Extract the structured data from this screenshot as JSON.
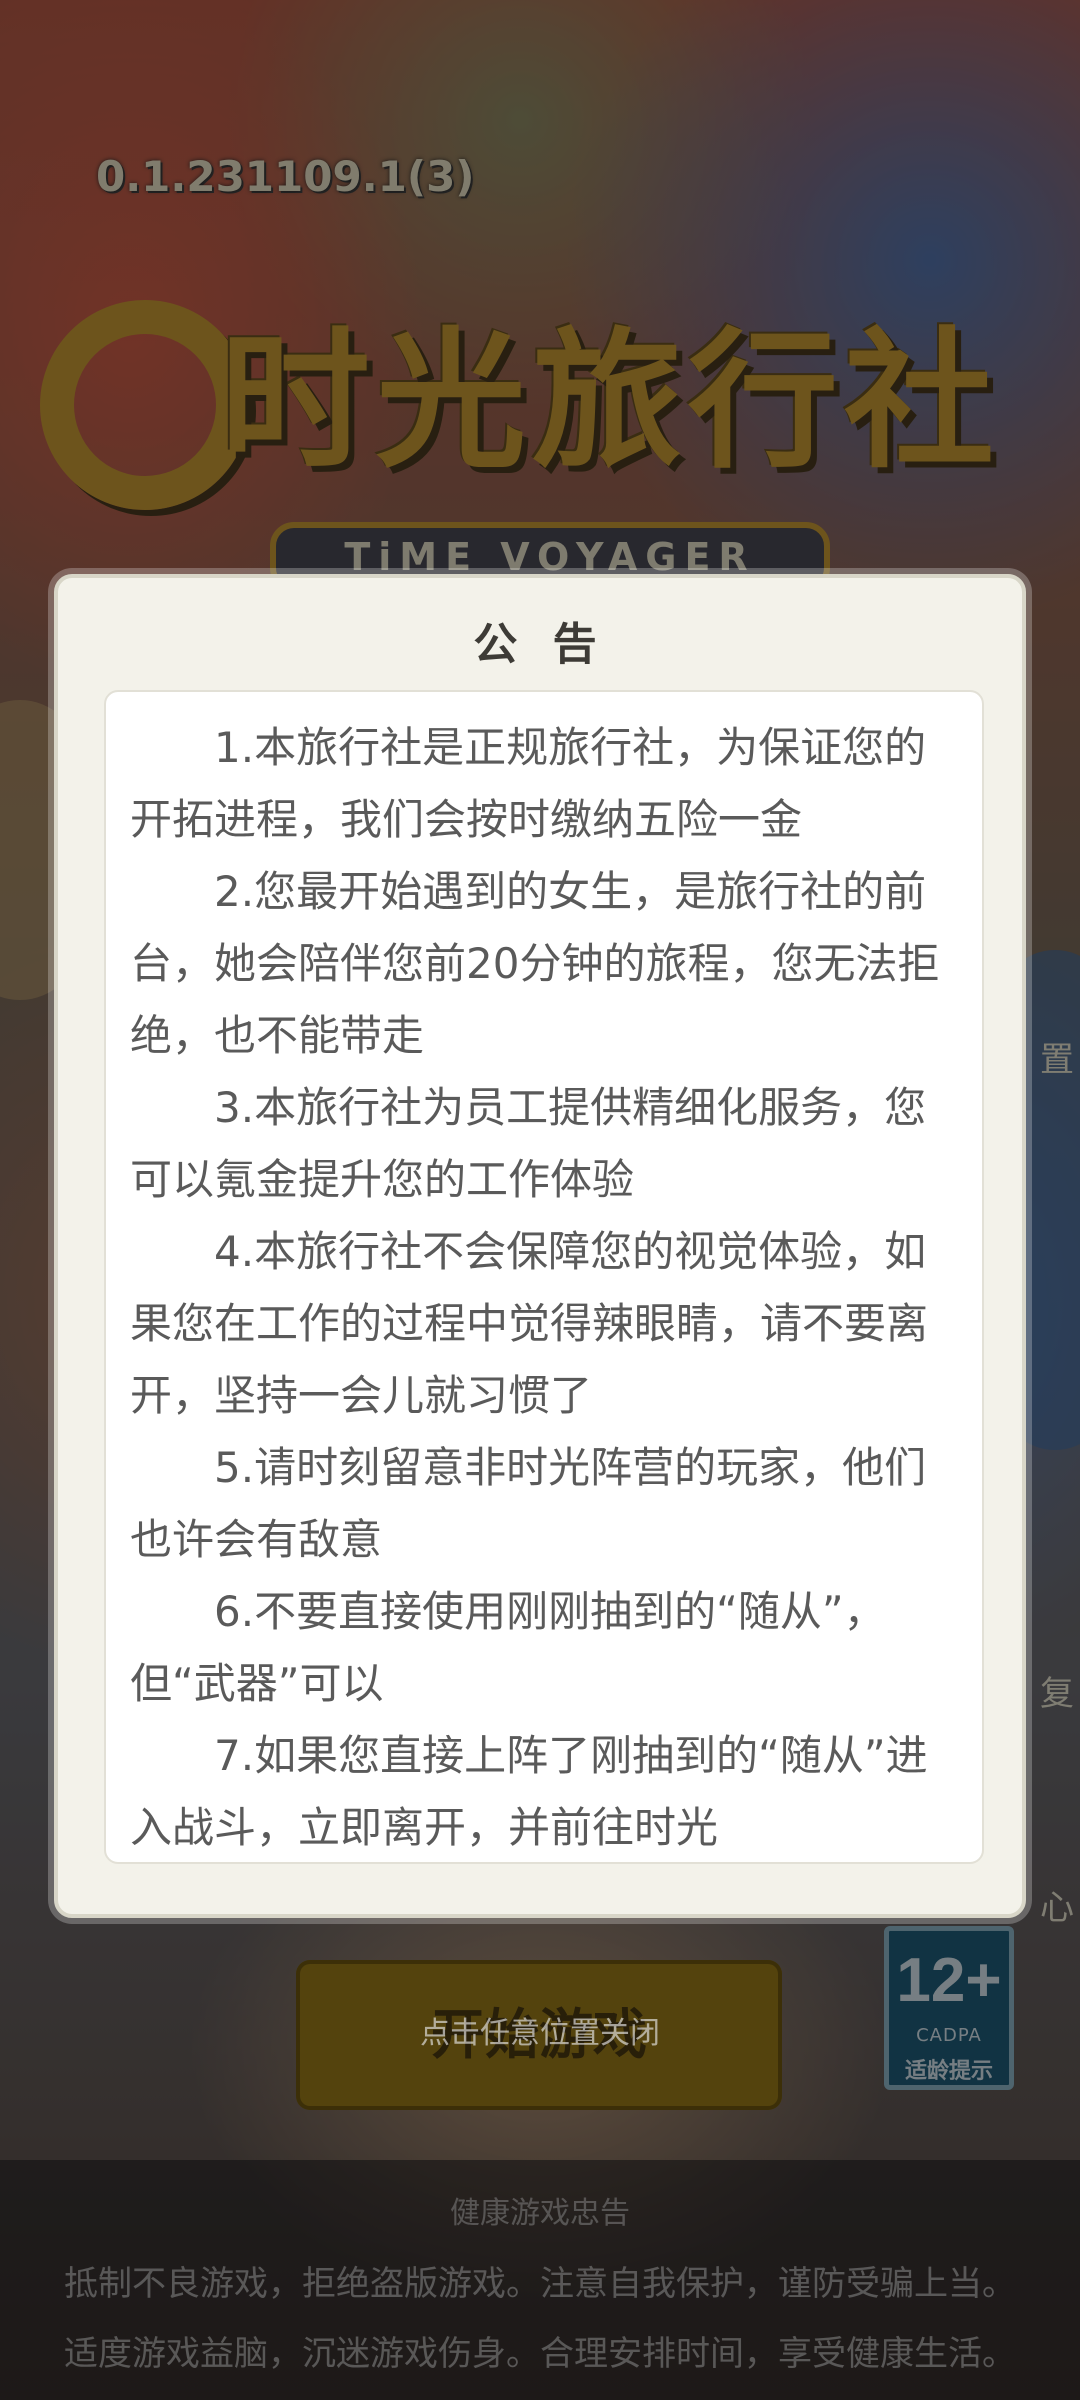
{
  "version": "0.1.231109.1(3)",
  "logo": {
    "title": "时光旅行社",
    "subtitle": "TiME VOYAGER"
  },
  "side_labels": {
    "right_top": "置",
    "right_mid": "复",
    "right_low": "心"
  },
  "dialog": {
    "title": "公 告",
    "paragraphs": [
      "1.本旅行社是正规旅行社，为保证您的开拓进程，我们会按时缴纳五险一金",
      "2.您最开始遇到的女生，是旅行社的前台，她会陪伴您前20分钟的旅程，您无法拒绝，也不能带走",
      "3.本旅行社为员工提供精细化服务，您可以氪金提升您的工作体验",
      "4.本旅行社不会保障您的视觉体验，如果您在工作的过程中觉得辣眼睛，请不要离开，坚持一会儿就习惯了",
      "5.请时刻留意非时光阵营的玩家，他们也许会有敌意",
      "6.不要直接使用刚刚抽到的“随从”，但“武器”可以",
      "7.如果您直接上阵了刚抽到的“随从”进入战斗，立即离开，并前往时光"
    ]
  },
  "start_button": {
    "label": "开始游戏",
    "overlay_hint": "点击任意位置关闭"
  },
  "age_rating": {
    "age": "12+",
    "org": "CADPA",
    "tip": "适龄提示"
  },
  "health_notice": {
    "title": "健康游戏忠告",
    "line1": "抵制不良游戏，拒绝盗版游戏。注意自我保护，谨防受骗上当。",
    "line2": "适度游戏益脑，沉迷游戏伤身。合理安排时间，享受健康生活。"
  },
  "colors": {
    "dialog_bg": "#f3f2ea",
    "dialog_body_bg": "#ffffff",
    "text": "#5a5a5a",
    "button": "#9a7a18",
    "cadpa": "#1f5e7a"
  }
}
